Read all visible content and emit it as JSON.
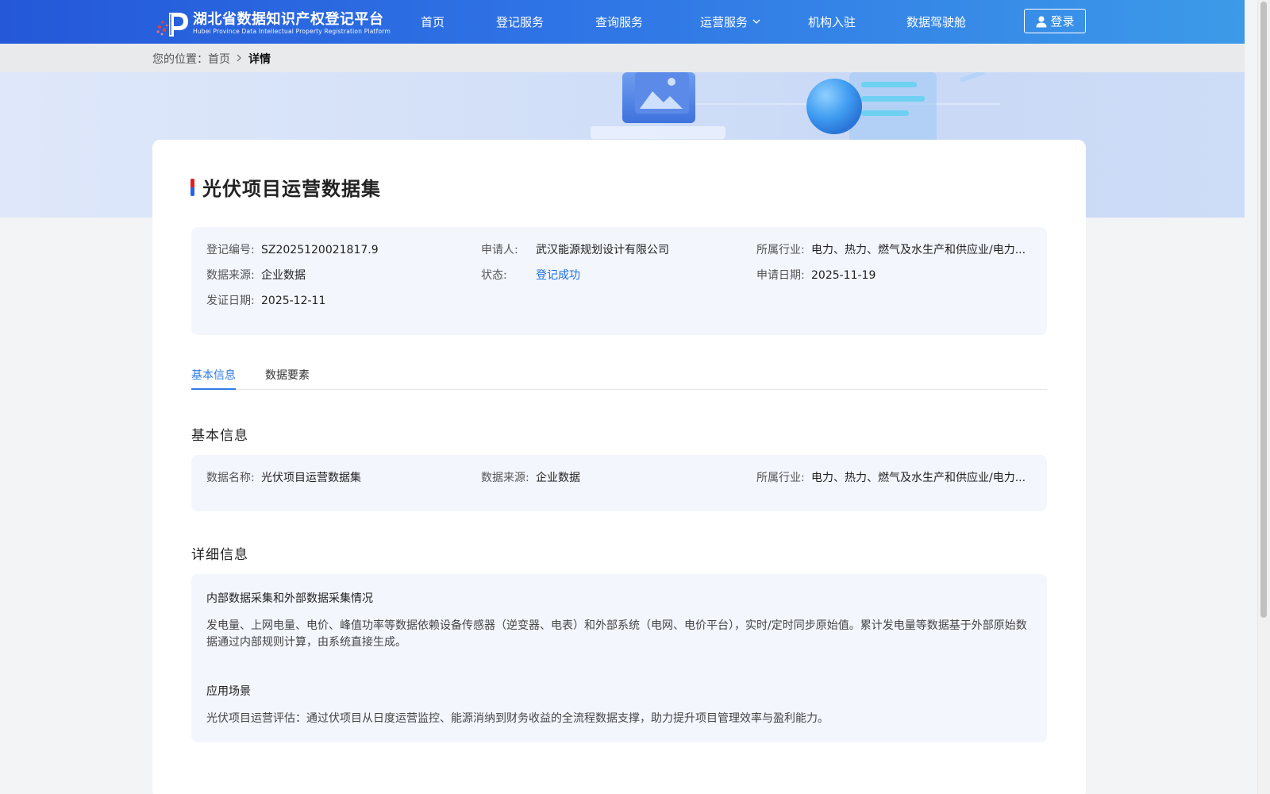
{
  "header": {
    "logo_cn": "湖北省数据知识产权登记平台",
    "logo_en": "Hubei Province Data Intellectual Property Registration Platform",
    "nav": [
      {
        "label": "首页"
      },
      {
        "label": "登记服务"
      },
      {
        "label": "查询服务"
      },
      {
        "label": "运营服务",
        "has_dropdown": true
      },
      {
        "label": "机构入驻"
      },
      {
        "label": "数据驾驶舱"
      }
    ],
    "login_label": "登录"
  },
  "breadcrumb": {
    "prefix": "您的位置：",
    "home": "首页",
    "current": "详情"
  },
  "title": "光伏项目运营数据集",
  "summary": {
    "reg_no_label": "登记编号:",
    "reg_no": "SZ2025120021817.9",
    "applicant_label": "申请人:",
    "applicant": "武汉能源规划设计有限公司",
    "industry_label": "所属行业:",
    "industry": "电力、热力、燃气及水生产和供应业/电力...",
    "source_label": "数据来源:",
    "source": "企业数据",
    "status_label": "状态:",
    "status": "登记成功",
    "apply_date_label": "申请日期:",
    "apply_date": "2025-11-19",
    "issue_date_label": "发证日期:",
    "issue_date": "2025-12-11"
  },
  "tabs": [
    {
      "label": "基本信息",
      "active": true
    },
    {
      "label": "数据要素",
      "active": false
    }
  ],
  "basic_info": {
    "heading": "基本信息",
    "name_label": "数据名称:",
    "name": "光伏项目运营数据集",
    "source_label": "数据来源:",
    "source": "企业数据",
    "industry_label": "所属行业:",
    "industry": "电力、热力、燃气及水生产和供应业/电力..."
  },
  "detail_info": {
    "heading": "详细信息",
    "collect_title": "内部数据采集和外部数据采集情况",
    "collect_text": "发电量、上网电量、电价、峰值功率等数据依赖设备传感器（逆变器、电表）和外部系统（电网、电价平台），实时/定时同步原始值。累计发电量等数据基于外部原始数据通过内部规则计算，由系统直接生成。",
    "scene_title": "应用场景",
    "scene_text": "光伏项目运营评估：通过伏项目从日度运营监控、能源消纳到财务收益的全流程数据支撑，助力提升项目管理效率与盈利能力。"
  },
  "colors": {
    "header_start": "#2458d8",
    "header_end": "#3c9ae8",
    "accent": "#2f7ae8",
    "status_link": "#1e6fe0",
    "panel_bg": "#f3f6fd"
  }
}
